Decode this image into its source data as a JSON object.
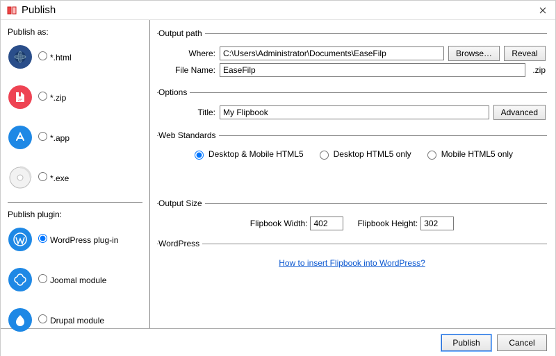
{
  "window": {
    "title": "Publish"
  },
  "sidebar": {
    "publish_as_label": "Publish as:",
    "formats": [
      {
        "label": "*.html"
      },
      {
        "label": "*.zip"
      },
      {
        "label": "*.app"
      },
      {
        "label": "*.exe"
      }
    ],
    "plugin_label": "Publish plugin:",
    "plugins": [
      {
        "label": "WordPress plug-in"
      },
      {
        "label": "Joomal module"
      },
      {
        "label": "Drupal module"
      }
    ]
  },
  "output_path": {
    "legend": "Output path",
    "where_label": "Where:",
    "where_value": "C:\\Users\\Administrator\\Documents\\EaseFilp",
    "browse_label": "Browse…",
    "reveal_label": "Reveal",
    "filename_label": "File Name:",
    "filename_value": "EaseFilp",
    "filename_suffix": ".zip"
  },
  "options": {
    "legend": "Options",
    "title_label": "Title:",
    "title_value": "My Flipbook",
    "advanced_label": "Advanced"
  },
  "web_standards": {
    "legend": "Web Standards",
    "options": [
      "Desktop & Mobile HTML5",
      "Desktop HTML5 only",
      "Mobile HTML5 only"
    ]
  },
  "output_size": {
    "legend": "Output Size",
    "width_label": "Flipbook Width:",
    "width_value": "402",
    "height_label": "Flipbook Height:",
    "height_value": "302"
  },
  "wordpress": {
    "legend": "WordPress",
    "link_text": "How to insert Flipbook into WordPress?"
  },
  "footer": {
    "publish_label": "Publish",
    "cancel_label": "Cancel"
  }
}
